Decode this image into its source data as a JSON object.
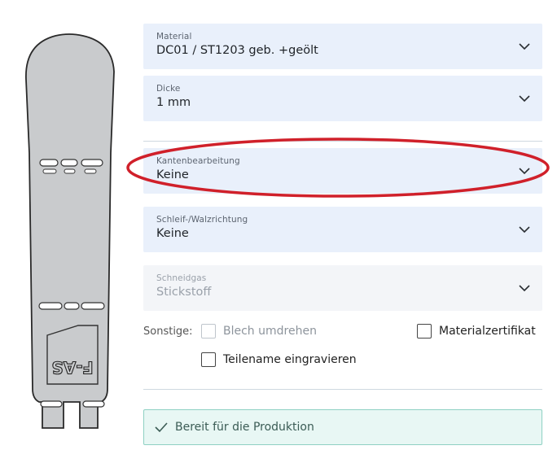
{
  "fields": [
    {
      "label": "Material",
      "value": "DC01 / ST1203 geb. +geölt",
      "disabled": false
    },
    {
      "label": "Dicke",
      "value": "1 mm",
      "disabled": false
    },
    {
      "label": "Kantenbearbeitung",
      "value": "Keine",
      "disabled": false
    },
    {
      "label": "Schleif-/Walzrichtung",
      "value": "Keine",
      "disabled": false
    },
    {
      "label": "Schneidgas",
      "value": "Stickstoff",
      "disabled": true
    }
  ],
  "other": {
    "label": "Sonstige:",
    "options": [
      {
        "label": "Blech umdrehen",
        "checked": false,
        "disabled": true
      },
      {
        "label": "Materialzertifikat",
        "checked": false,
        "disabled": false
      },
      {
        "label": "Teilename eingravieren",
        "checked": false,
        "disabled": false
      }
    ]
  },
  "status": {
    "text": "Bereit für die Produktion",
    "icon": "check-icon",
    "color": "#8fd1c3"
  },
  "highlight": {
    "color": "#d0202a",
    "target": "Kantenbearbeitung"
  },
  "preview": {
    "engraving": "F-AS"
  }
}
